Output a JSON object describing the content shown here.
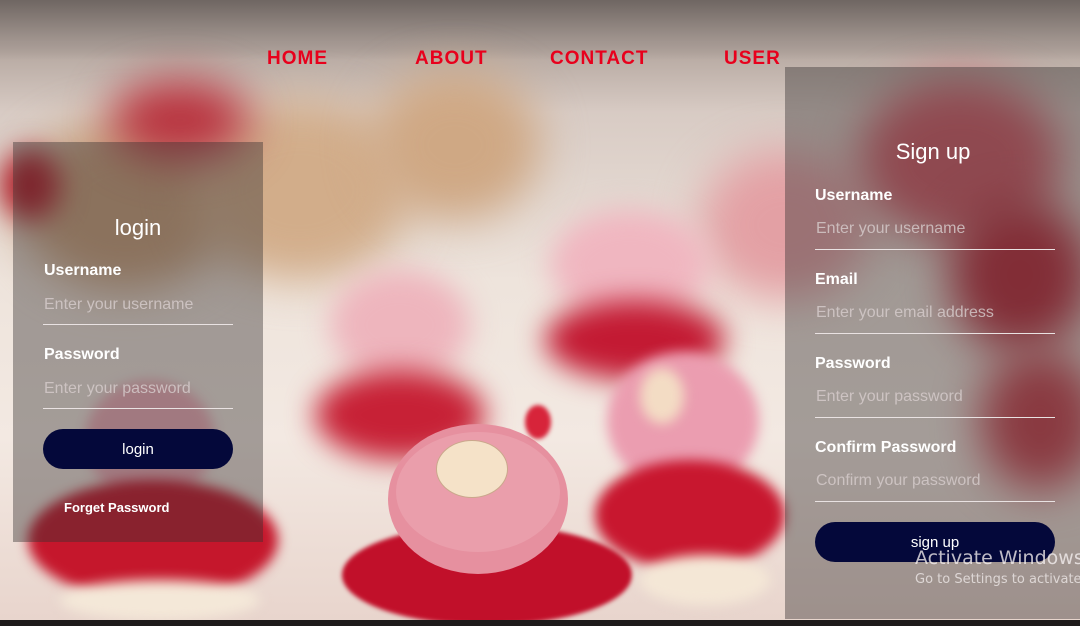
{
  "nav": {
    "items": [
      {
        "label": "HOME"
      },
      {
        "label": "ABOUT"
      },
      {
        "label": "CONTACT"
      },
      {
        "label": "USER"
      }
    ]
  },
  "login": {
    "title": "login",
    "username_label": "Username",
    "username_placeholder": "Enter your username",
    "password_label": "Password",
    "password_placeholder": "Enter your password",
    "button_label": "login",
    "forgot_label": "Forget Password"
  },
  "signup": {
    "title": "Sign up",
    "username_label": "Username",
    "username_placeholder": "Enter your username",
    "email_label": "Email",
    "email_placeholder": "Enter your email address",
    "password_label": "Password",
    "password_placeholder": "Enter your password",
    "confirm_label": "Confirm Password",
    "confirm_placeholder": "Confirm your password",
    "button_label": "sign up"
  },
  "watermark": {
    "title": "Activate Windows",
    "subtitle": "Go to Settings to activate"
  },
  "colors": {
    "nav_text": "#e8001c",
    "button_bg": "#04083a",
    "panel_bg": "rgba(55,50,50,0.42)"
  }
}
